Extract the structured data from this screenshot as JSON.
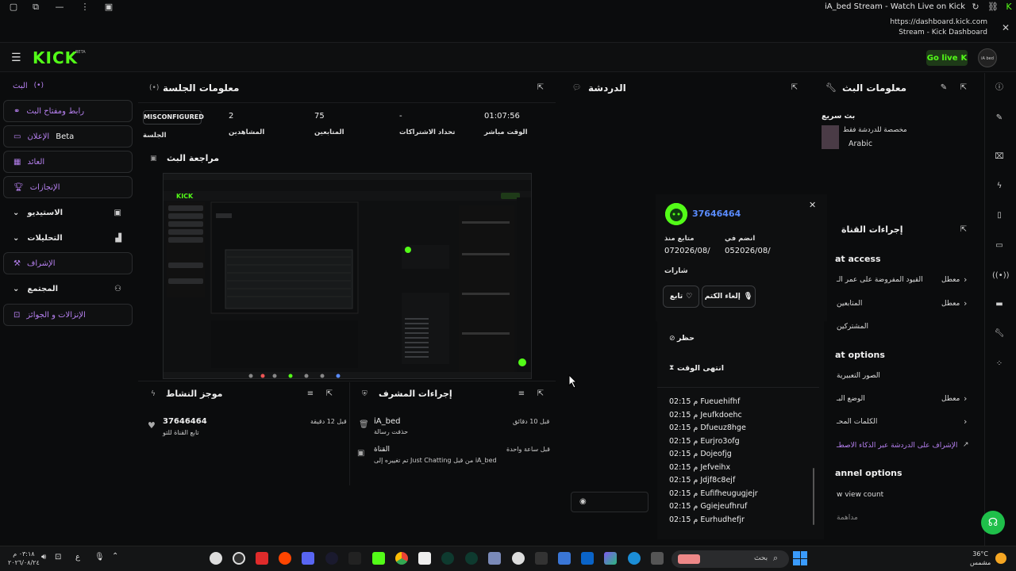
{
  "browser": {
    "window_title": "iA_bed Stream - Watch Live on Kick",
    "url": "https://dashboard.kick.com",
    "page_title": "Stream - Kick Dashboard"
  },
  "header": {
    "logo": "KICK",
    "beta": "BETA",
    "go_live": "Go live",
    "avatar_text": "iA bed"
  },
  "nav": {
    "items": [
      {
        "label": "البث",
        "extra": "(•)"
      },
      {
        "label": "رابط ومفتاح البث"
      },
      {
        "label": "الإعلان",
        "badge": "Beta"
      },
      {
        "label": "العائد"
      },
      {
        "label": "الإنجازات"
      }
    ],
    "sections": [
      {
        "label": "الاستيديو"
      },
      {
        "label": "التحليلات"
      },
      {
        "label": "الإشراف"
      },
      {
        "label": "المجتمع"
      },
      {
        "label": "الإنزالات و الجوائز"
      }
    ]
  },
  "session": {
    "title": "معلومات الجلسة",
    "badge": "MISCONFIGURED",
    "badge_label": "الجلسة",
    "stats": [
      {
        "value": "2",
        "label": "المشاهدين"
      },
      {
        "value": "75",
        "label": "المتابعين"
      },
      {
        "value": "-",
        "label": "تحداد الاشتراكات"
      },
      {
        "value": "01:07:56",
        "label": "الوقت مباشر"
      }
    ]
  },
  "preview": {
    "title": "مراجعة البث"
  },
  "chat": {
    "title": "الدردشة"
  },
  "stream_info": {
    "title": "معلومات البث",
    "stream_name": "بث سريع",
    "category": "مخصصة للدردشة فقط",
    "language": "Arabic"
  },
  "user_card": {
    "username": "37646464",
    "followed_label": "متابع منذ",
    "followed_date": "072026/08/",
    "joined_label": "انضم في",
    "joined_date": "052026/08/",
    "badges_label": "شارات",
    "follow_btn": "تابع",
    "unmute_btn": "إلغاء الكتم",
    "ban_label": "حظر",
    "timeout_label": "انتهى الوقت"
  },
  "timeouts": [
    {
      "time": "02:15 م",
      "name": "Fueuehifhf"
    },
    {
      "time": "02:15 م",
      "name": "Jeufkdoehc"
    },
    {
      "time": "02:15 م",
      "name": "Dfueuz8hge"
    },
    {
      "time": "02:15 م",
      "name": "Eurjro3ofg"
    },
    {
      "time": "02:15 م",
      "name": "Dojeofjg"
    },
    {
      "time": "02:15 م",
      "name": "Jefveihx"
    },
    {
      "time": "02:15 م",
      "name": "Jdjf8c8ejf"
    },
    {
      "time": "02:15 م",
      "name": "Eufifheugugjejr"
    },
    {
      "time": "02:15 م",
      "name": "Ggiejeufhruf"
    },
    {
      "time": "02:15 م",
      "name": "Eurhudhefjr"
    }
  ],
  "channel_actions": {
    "title": "إجراءات القناة",
    "chat_access": "at access",
    "rows": [
      {
        "label": "القيود المفروضة على عمر الـ",
        "value": "معطل"
      },
      {
        "label": "المتابعين",
        "value": "معطل"
      },
      {
        "label": "المشتركين",
        "value": ""
      }
    ],
    "chat_options": "at options",
    "rows2": [
      {
        "label": "الصور التعبيرية",
        "value": ""
      },
      {
        "label": "الوضع البـ",
        "value": "معطل"
      },
      {
        "label": "الكلمات المحـ",
        "value": ""
      },
      {
        "label": "الإشراف على الدردشة عبر الذكاء الاصطـ",
        "value": ""
      }
    ],
    "channel_options": "annel options",
    "view_count": "w view count",
    "more": "مداهمة"
  },
  "activity": {
    "title": "موجز النشاط",
    "user": "37646464",
    "action": "تابع القناة للتو",
    "time": "قبل 12 دقيقة"
  },
  "mod_actions": {
    "title": "إجراءات المشرف",
    "items": [
      {
        "user": "iA_bed",
        "action": "حذفت رسالة",
        "time": "قبل 10 دقائق"
      },
      {
        "user": "القناة",
        "action": "تم تغييره إلى Just Chatting من قبل iA_bed",
        "time": "قبل ساعة واحدة"
      }
    ]
  },
  "taskbar": {
    "time": "٠٣:١٨ م",
    "date": "٢٠٢٦/٠٨/٢٤",
    "weather": "36°C",
    "weather_desc": "مشمس",
    "search": "بحث",
    "lang": "ع"
  }
}
